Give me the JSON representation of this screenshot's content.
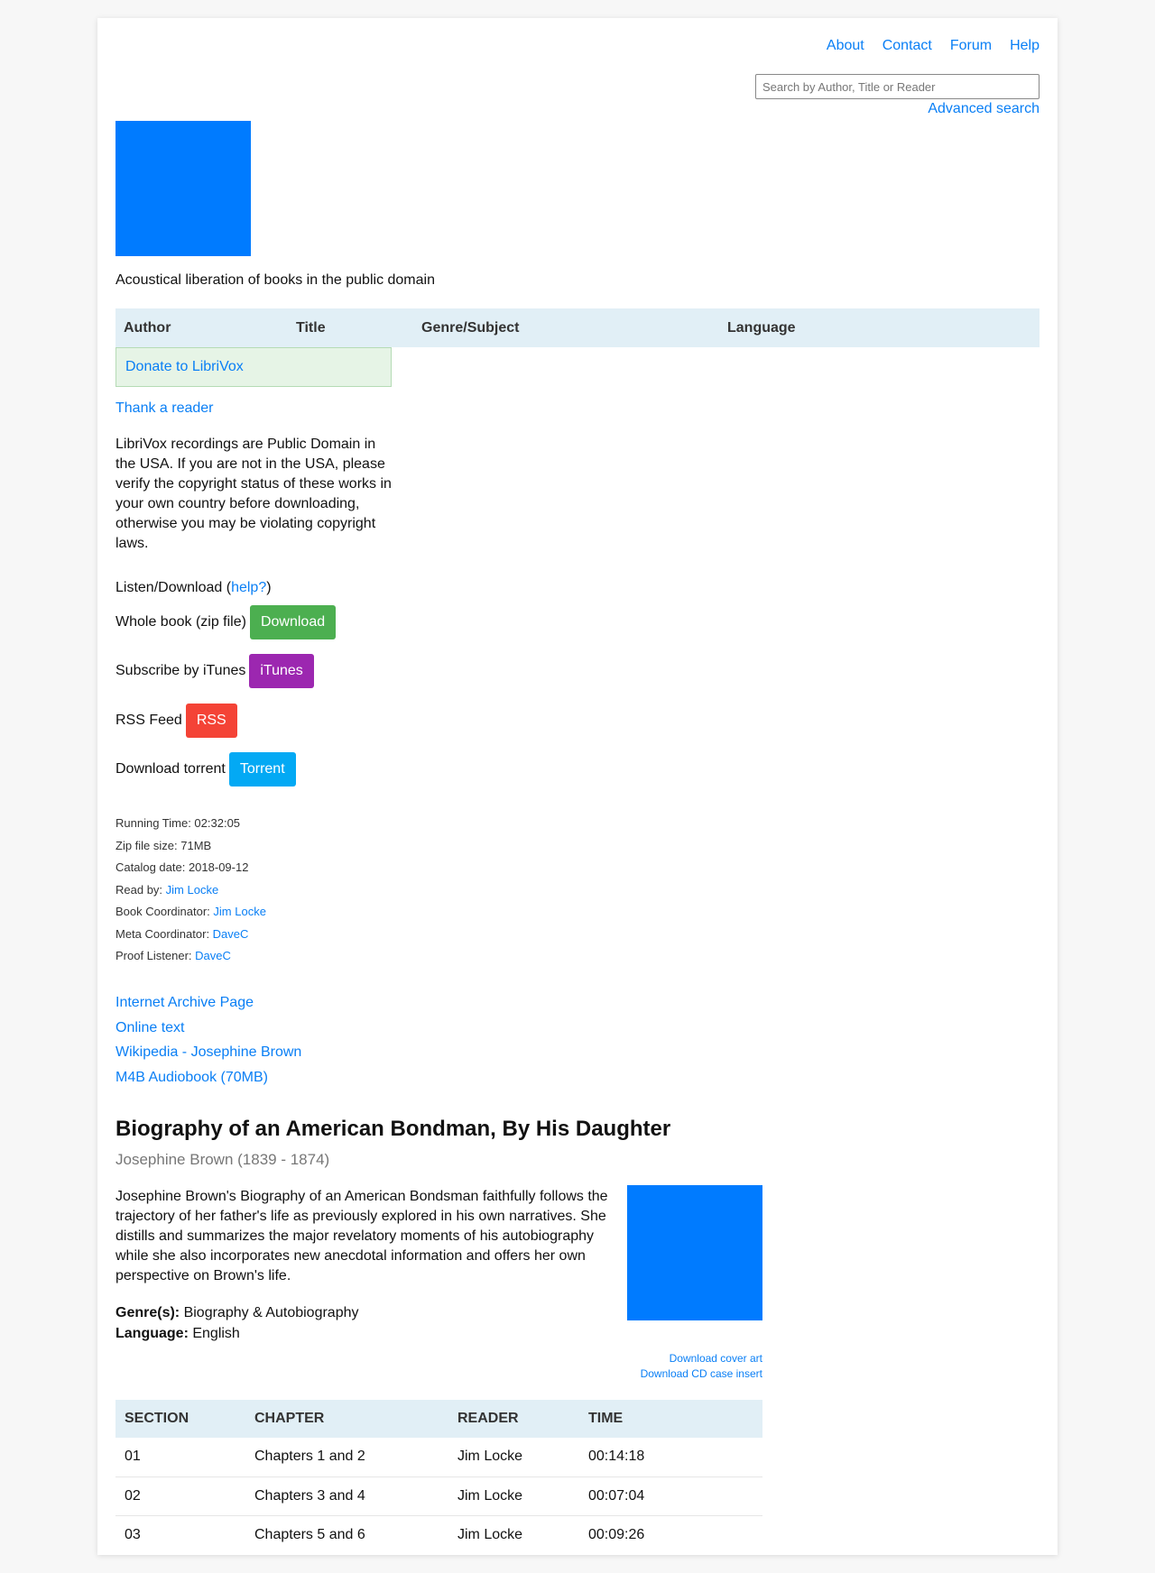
{
  "nav": {
    "about": "About",
    "contact": "Contact",
    "forum": "Forum",
    "help": "Help"
  },
  "search": {
    "placeholder": "Search by Author, Title or Reader",
    "advanced": "Advanced search"
  },
  "tagline": "Acoustical liberation of books in the public domain",
  "menubar": {
    "author": "Author",
    "title": "Title",
    "genre": "Genre/Subject",
    "language": "Language"
  },
  "sidebar": {
    "donate": "Donate to LibriVox",
    "thank": "Thank a reader",
    "copyright": "LibriVox recordings are Public Domain in the USA. If you are not in the USA, please verify the copyright status of these works in your own country before downloading, otherwise you may be violating copyright laws.",
    "listen_prefix": "Listen/Download (",
    "listen_help": "help?",
    "listen_suffix": ")",
    "whole_book_label": "Whole book (zip file)",
    "download_btn": "Download",
    "itunes_label": "Subscribe by iTunes",
    "itunes_btn": "iTunes",
    "rss_label": "RSS Feed",
    "rss_btn": "RSS",
    "torrent_label": "Download torrent",
    "torrent_btn": "Torrent",
    "meta": {
      "running_time": "Running Time: 02:32:05",
      "zip_size": "Zip file size: 71MB",
      "catalog_date": "Catalog date: 2018-09-12",
      "read_by_label": "Read by: ",
      "read_by": "Jim Locke",
      "book_coord_label": "Book Coordinator: ",
      "book_coord": "Jim Locke",
      "meta_coord_label": "Meta Coordinator: ",
      "meta_coord": "DaveC",
      "proof_label": "Proof Listener: ",
      "proof": "DaveC"
    },
    "links": {
      "archive": "Internet Archive Page",
      "online_text": "Online text",
      "wikipedia": "Wikipedia - Josephine Brown",
      "m4b": "M4B Audiobook (70MB)"
    }
  },
  "book": {
    "title": "Biography of an American Bondman, By His Daughter",
    "author": "Josephine Brown (1839 - 1874)",
    "description": "Josephine Brown's Biography of an American Bondsman faithfully follows the trajectory of her father's life as previously explored in his own narratives. She distills and summarizes the major revelatory moments of his autobiography while she also incorporates new anecdotal information and offers her own perspective on Brown's life.",
    "genre_label": "Genre(s):",
    "genre": "Biography & Autobiography",
    "language_label": "Language:",
    "language": "English",
    "download_cover": "Download cover art",
    "download_cd": "Download CD case insert"
  },
  "sections": {
    "headers": [
      "SECTION",
      "CHAPTER",
      "READER",
      "TIME"
    ],
    "rows": [
      [
        "01",
        "Chapters 1 and 2",
        "Jim Locke",
        "00:14:18"
      ],
      [
        "02",
        "Chapters 3 and 4",
        "Jim Locke",
        "00:07:04"
      ],
      [
        "03",
        "Chapters 5 and 6",
        "Jim Locke",
        "00:09:26"
      ]
    ]
  },
  "colors": {
    "accent": "#0a7ff5",
    "download": "#4caf50",
    "itunes": "#9c27b0",
    "rss": "#f44336",
    "torrent": "#03a9f4",
    "table_header": "#e1eff6",
    "donate_bg": "#e6f4e6"
  }
}
